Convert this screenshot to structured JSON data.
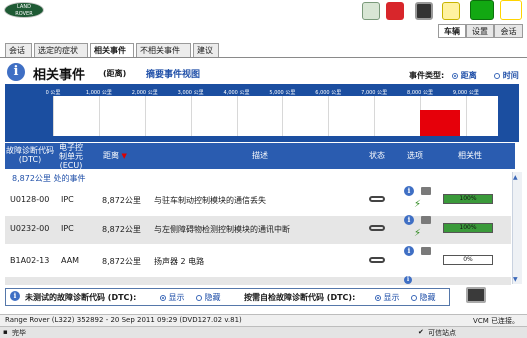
{
  "logo": {
    "line1": "LAND",
    "line2": "ROVER"
  },
  "main_tabs": [
    {
      "label": "车辆",
      "active": true
    },
    {
      "label": "设置",
      "active": false
    },
    {
      "label": "会话",
      "active": false
    }
  ],
  "sub_tabs": [
    {
      "label": "会话",
      "active": false
    },
    {
      "label": "选定的症状",
      "active": false
    },
    {
      "label": "相关事件",
      "active": true
    },
    {
      "label": "不相关事件",
      "active": false
    },
    {
      "label": "建议",
      "active": false
    }
  ],
  "page": {
    "title": "相关事件",
    "subtitle": "(距离)",
    "summary_link": "摘要事件视图",
    "event_type_label": "事件类型:",
    "event_type_options": [
      "距离",
      "时间"
    ]
  },
  "chart_data": {
    "type": "bar",
    "x_ticks": [
      "0 公里",
      "1,000 公里",
      "2,000 公里",
      "3,000 公里",
      "4,000 公里",
      "5,000 公里",
      "6,000 公里",
      "7,000 公里",
      "8,000 公里",
      "9,000 公里"
    ],
    "xlim": [
      0,
      9700
    ],
    "bars": [
      {
        "start": 8000,
        "end": 8872,
        "color": "#e6000a"
      }
    ]
  },
  "table": {
    "headers": {
      "dtc": "故障诊断代码 (DTC)",
      "ecu": "电子控制单元 (ECU)",
      "distance": "距离",
      "description": "描述",
      "status": "状态",
      "options": "选项",
      "relevance": "相关性"
    },
    "group_label": "8,872公里  处的事件",
    "rows": [
      {
        "dtc": "U0128-00",
        "ecu": "IPC",
        "distance": "8,872公里",
        "description": "与驻车制动控制模块的通信丢失",
        "relevance_label": "100%",
        "relevance": 1.0
      },
      {
        "dtc": "U0232-00",
        "ecu": "IPC",
        "distance": "8,872公里",
        "description": "与左侧障碍物检测控制模块的通讯中断",
        "relevance_label": "100%",
        "relevance": 1.0
      },
      {
        "dtc": "B1A02-13",
        "ecu": "AAM",
        "distance": "8,872公里",
        "description": "扬声器 2 电路",
        "relevance_label": "0%",
        "relevance": 0.0
      }
    ]
  },
  "filter": {
    "untested_label": "未测试的故障诊断代码 (DTC):",
    "show": "显示",
    "hide": "隐藏",
    "self_test_label": "按需自检故障诊断代码 (DTC):",
    "show2": "显示",
    "hide2": "隐藏"
  },
  "status_bar": {
    "vehicle": "Range Rover (L322) 352892 - 20 Sep 2011 09:29 (DVD127.02 v.81)",
    "connection": "VCM 已连接。",
    "browser_status": "完毕",
    "trusted_site": "可信站点"
  }
}
